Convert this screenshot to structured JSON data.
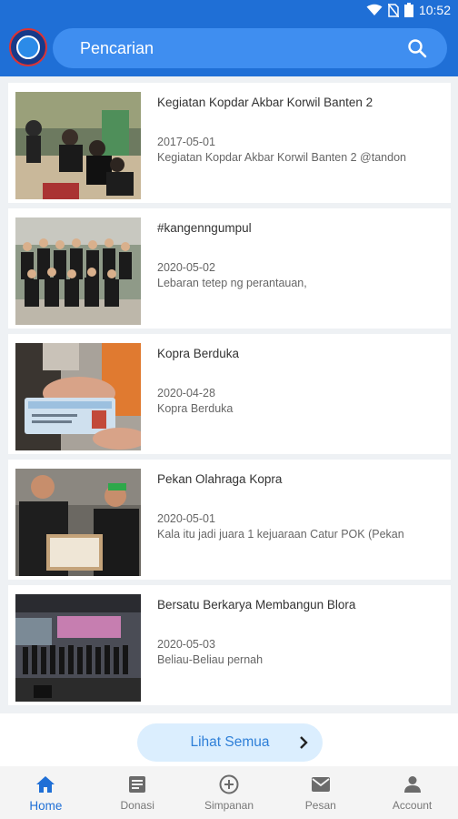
{
  "status_bar": {
    "time": "10:52"
  },
  "header": {
    "search_placeholder": "Pencarian"
  },
  "feed": {
    "items": [
      {
        "title": "Kegiatan Kopdar Akbar Korwil Banten 2",
        "date": "2017-05-01",
        "desc": "Kegiatan Kopdar Akbar Korwil Banten 2 @tandon"
      },
      {
        "title": "#kangenngumpul",
        "date": "2020-05-02",
        "desc": "Lebaran tetep ng perantauan,"
      },
      {
        "title": "Kopra Berduka",
        "date": "2020-04-28",
        "desc": "Kopra Berduka"
      },
      {
        "title": "Pekan Olahraga Kopra",
        "date": "2020-05-01",
        "desc": "Kala itu jadi juara 1 kejuaraan Catur POK (Pekan"
      },
      {
        "title": "Bersatu Berkarya Membangun Blora",
        "date": "2020-05-03",
        "desc": "Beliau-Beliau pernah"
      }
    ]
  },
  "see_all": {
    "label": "Lihat Semua"
  },
  "bottom_nav": {
    "items": [
      {
        "label": "Home",
        "icon": "home-icon",
        "active": true
      },
      {
        "label": "Donasi",
        "icon": "document-icon",
        "active": false
      },
      {
        "label": "Simpanan",
        "icon": "plus-circle-icon",
        "active": false
      },
      {
        "label": "Pesan",
        "icon": "mail-icon",
        "active": false
      },
      {
        "label": "Account",
        "icon": "person-icon",
        "active": false
      }
    ]
  },
  "colors": {
    "primary": "#1f6fd6",
    "search_bg": "#3f8ef0",
    "button_bg": "#dbeefe",
    "button_text": "#2e7fd8"
  }
}
